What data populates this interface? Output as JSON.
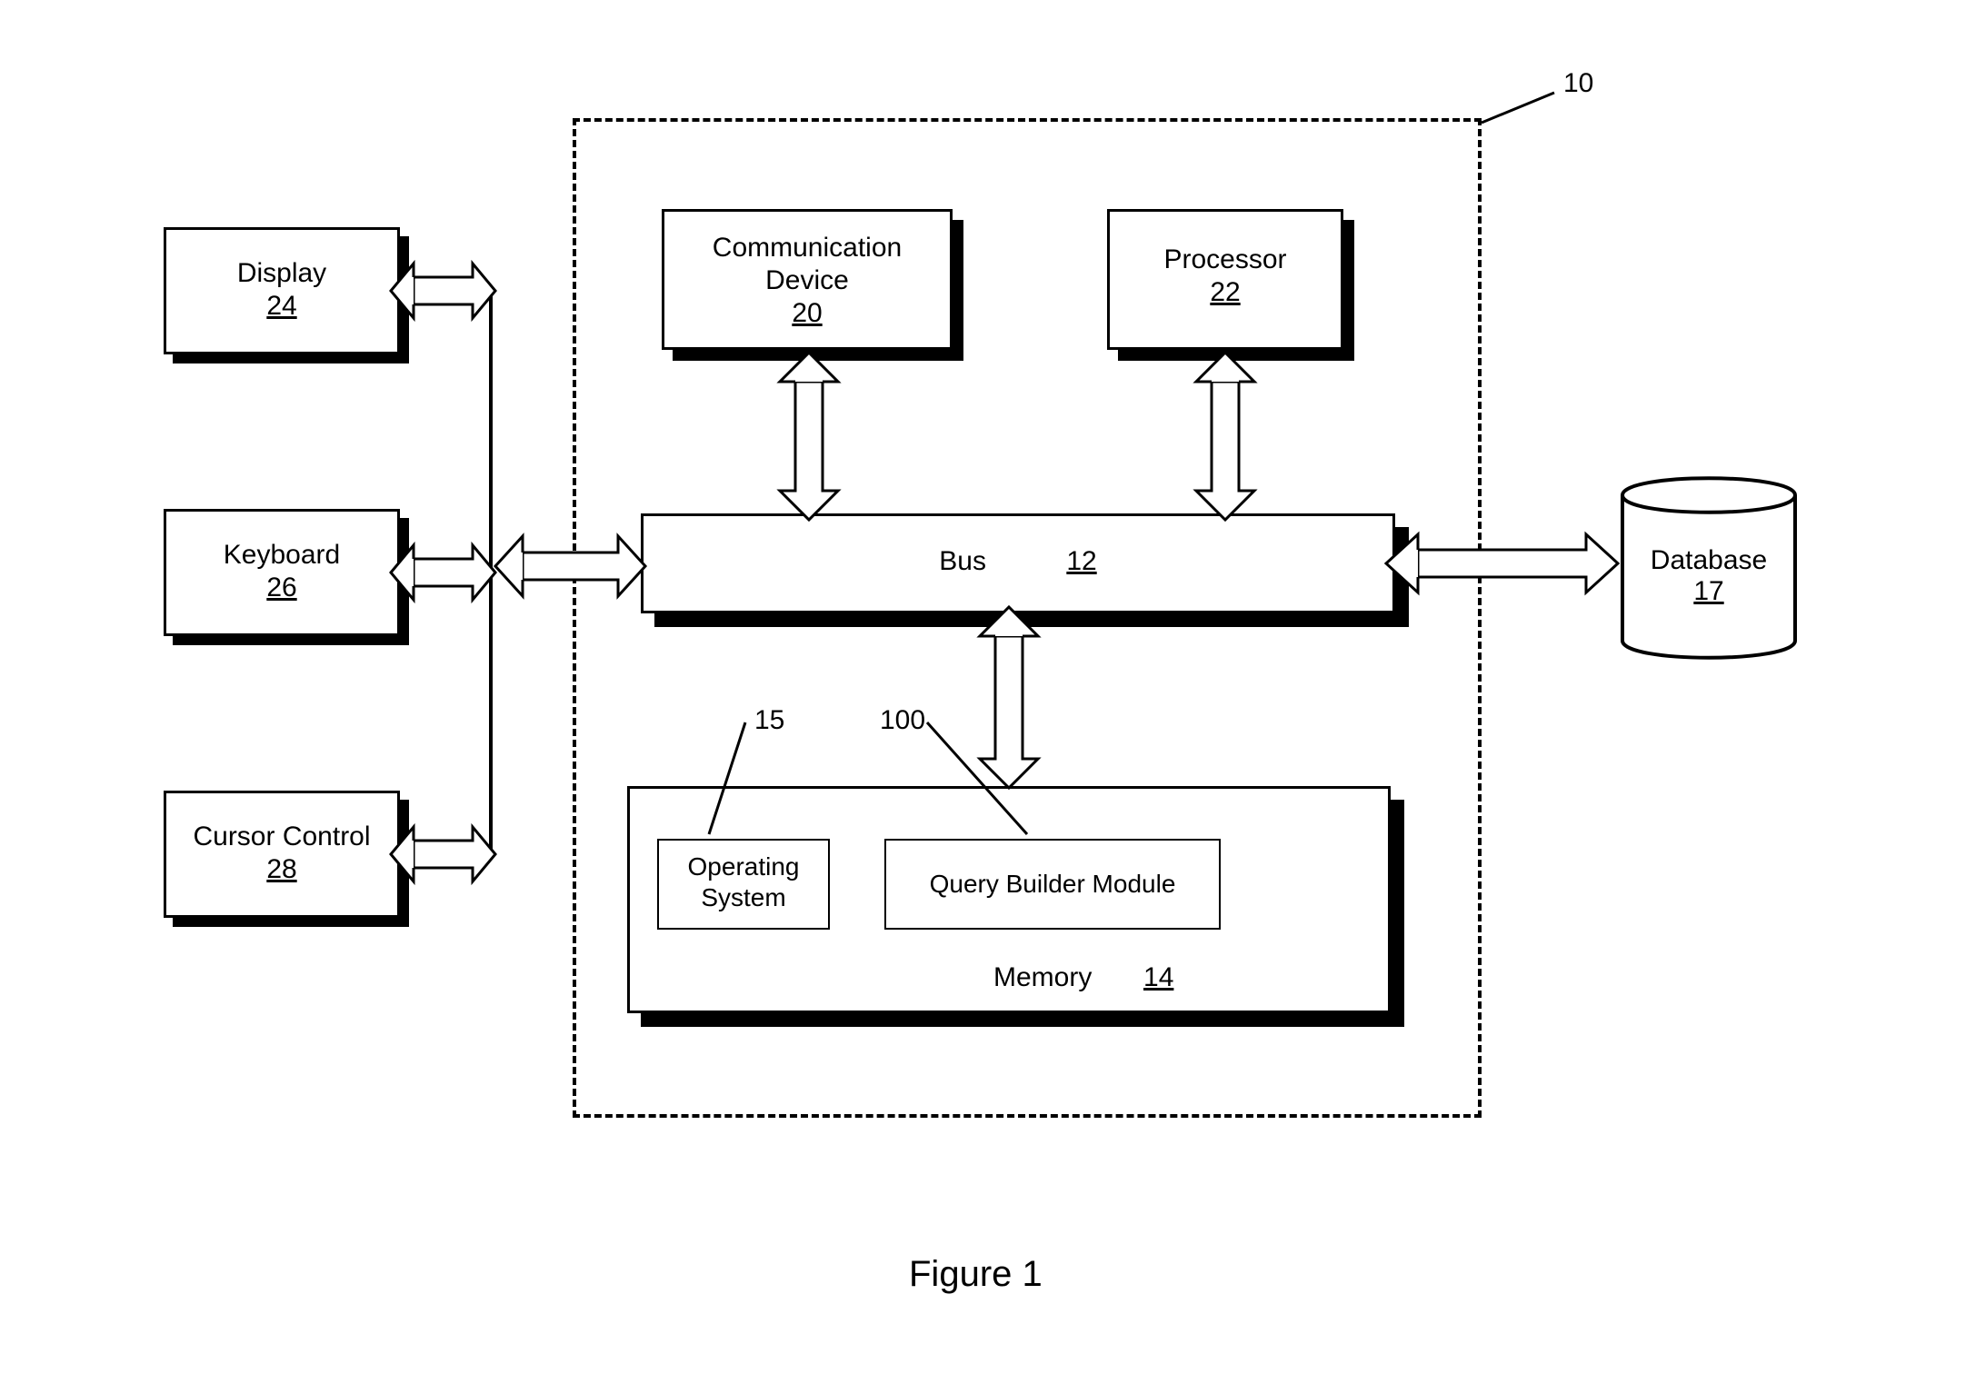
{
  "blocks": {
    "display": {
      "label": "Display",
      "num": "24"
    },
    "keyboard": {
      "label": "Keyboard",
      "num": "26"
    },
    "cursor": {
      "label": "Cursor Control",
      "num": "28"
    },
    "commdev": {
      "label": "Communication Device",
      "num": "20"
    },
    "processor": {
      "label": "Processor",
      "num": "22"
    },
    "bus": {
      "label": "Bus",
      "num": "12"
    },
    "os": {
      "label_l1": "Operating",
      "label_l2": "System"
    },
    "qbm": {
      "label": "Query Builder Module"
    },
    "memory": {
      "label": "Memory",
      "num": "14"
    },
    "database": {
      "label": "Database",
      "num": "17"
    }
  },
  "refs": {
    "system": "10",
    "os": "15",
    "qbm": "100"
  },
  "caption": "Figure 1"
}
